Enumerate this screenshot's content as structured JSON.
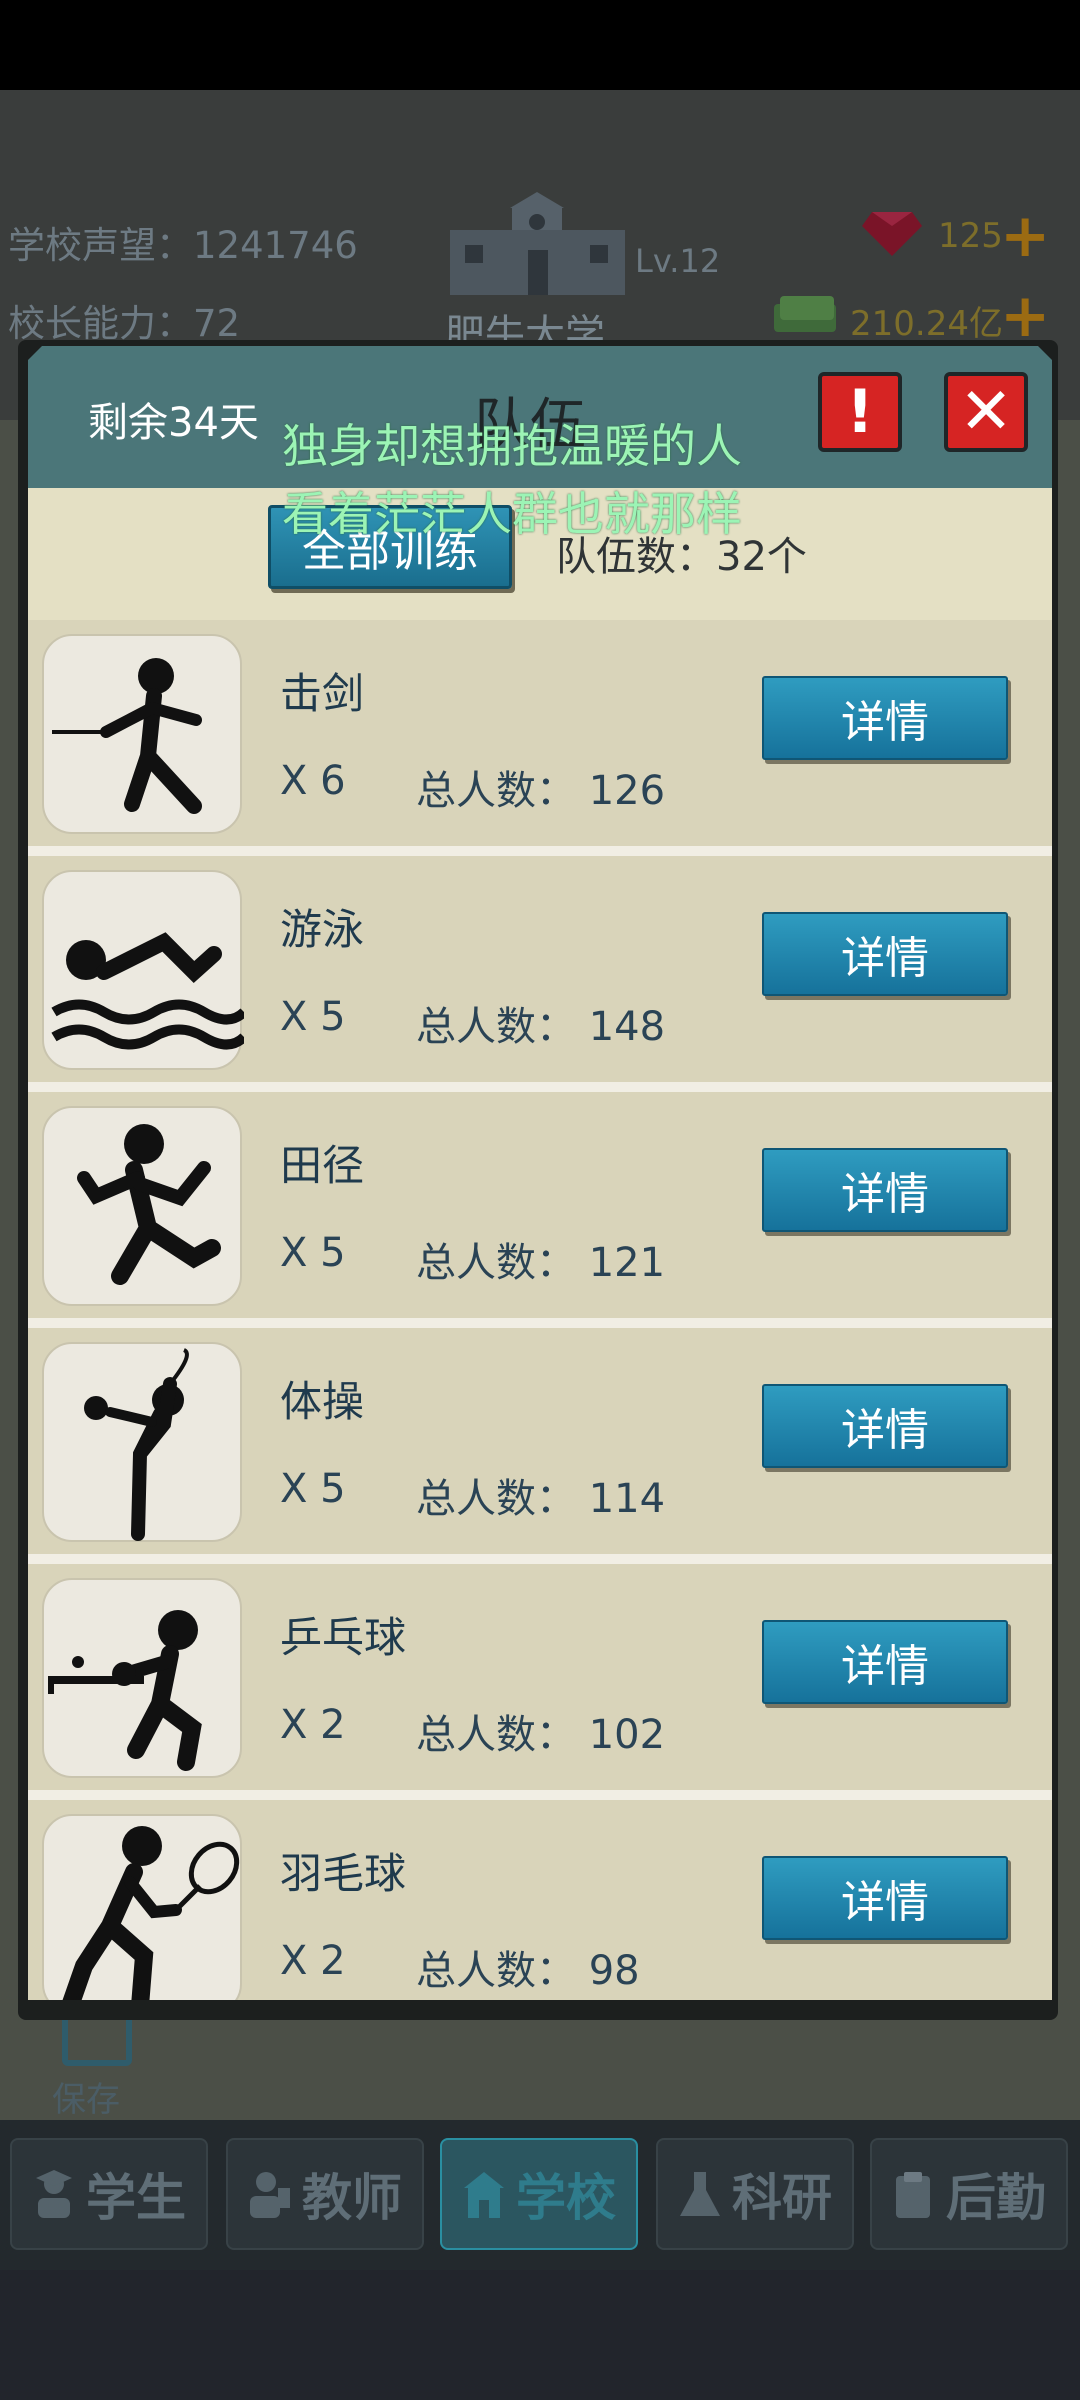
{
  "hud": {
    "reputation_label": "学校声望：",
    "reputation_value": "1241746",
    "ability_label": "校长能力：",
    "ability_value": "72",
    "level": "Lv.12",
    "school_name": "肥牛大学",
    "gems": "125",
    "money": "210.24亿"
  },
  "panel": {
    "days_left": "剩余34天",
    "title": "队伍",
    "alert_label": "!",
    "close_label": "✕",
    "train_all_label": "全部训练",
    "team_count_label": "队伍数：32个"
  },
  "lyrics": {
    "line1": "独身却想拥抱温暖的人",
    "line2": "看着茫茫人群也就那样"
  },
  "teams": [
    {
      "name": "击剑",
      "multiplier": "X 6",
      "total": "总人数：  126",
      "button": "详情",
      "icon": "fencing-icon"
    },
    {
      "name": "游泳",
      "multiplier": "X 5",
      "total": "总人数：  148",
      "button": "详情",
      "icon": "swimming-icon"
    },
    {
      "name": "田径",
      "multiplier": "X 5",
      "total": "总人数：  121",
      "button": "详情",
      "icon": "running-icon"
    },
    {
      "name": "体操",
      "multiplier": "X 5",
      "total": "总人数：  114",
      "button": "详情",
      "icon": "gymnastics-icon"
    },
    {
      "name": "乒乓球",
      "multiplier": "X 2",
      "total": "总人数：  102",
      "button": "详情",
      "icon": "table-tennis-icon"
    },
    {
      "name": "羽毛球",
      "multiplier": "X 2",
      "total": "总人数：  98",
      "button": "详情",
      "icon": "badminton-icon"
    }
  ],
  "save_label": "保存",
  "nav": [
    {
      "label": "学生",
      "icon": "student-icon"
    },
    {
      "label": "教师",
      "icon": "teacher-icon"
    },
    {
      "label": "学校",
      "icon": "school-icon"
    },
    {
      "label": "科研",
      "icon": "research-icon"
    },
    {
      "label": "后勤",
      "icon": "logistics-icon"
    }
  ],
  "colors": {
    "panel_header": "#4b7679",
    "button_blue": "#1a7fa6",
    "close_red": "#d62423",
    "row_bg": "#d9d4ba"
  }
}
